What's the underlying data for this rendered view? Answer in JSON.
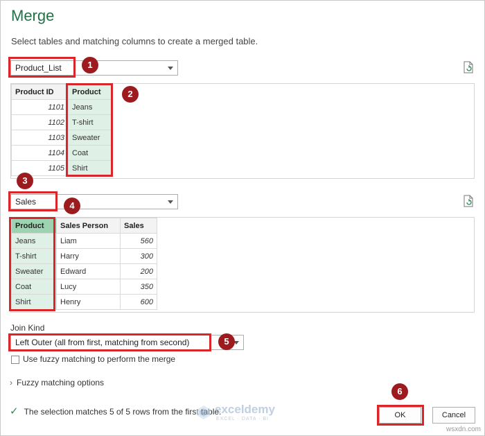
{
  "dialog": {
    "title": "Merge",
    "subtitle": "Select tables and matching columns to create a merged table."
  },
  "first_table": {
    "dropdown_value": "Product_List",
    "columns": [
      "Product ID",
      "Product"
    ],
    "rows": [
      [
        "1101",
        "Jeans"
      ],
      [
        "1102",
        "T-shirt"
      ],
      [
        "1103",
        "Sweater"
      ],
      [
        "1104",
        "Coat"
      ],
      [
        "1105",
        "Shirt"
      ]
    ]
  },
  "second_table": {
    "dropdown_value": "Sales",
    "columns": [
      "Product",
      "Sales Person",
      "Sales"
    ],
    "rows": [
      [
        "Jeans",
        "Liam",
        "560"
      ],
      [
        "T-shirt",
        "Harry",
        "300"
      ],
      [
        "Sweater",
        "Edward",
        "200"
      ],
      [
        "Coat",
        "Lucy",
        "350"
      ],
      [
        "Shirt",
        "Henry",
        "600"
      ]
    ]
  },
  "join": {
    "label": "Join Kind",
    "value": "Left Outer (all from first, matching from second)"
  },
  "fuzzy": {
    "checkbox_label": "Use fuzzy matching to perform the merge",
    "options_label": "Fuzzy matching options"
  },
  "status": {
    "message": "The selection matches 5 of 5 rows from the first table."
  },
  "buttons": {
    "ok": "OK",
    "cancel": "Cancel"
  },
  "badges": [
    "1",
    "2",
    "3",
    "4",
    "5",
    "6"
  ],
  "watermark": {
    "name": "exceldemy",
    "tagline": "EXCEL · DATA · BI"
  },
  "site_mark": "wsxdn.com",
  "colors": {
    "accent_green": "#217346",
    "selected_column": "#dff0e6",
    "selected_header": "#9ed3b1",
    "annotation_red": "#d9262b",
    "badge_red": "#9d1b1e"
  },
  "icons": [
    "refresh-icon",
    "checkmark-icon",
    "chevron-right-icon",
    "chevron-down-icon"
  ]
}
